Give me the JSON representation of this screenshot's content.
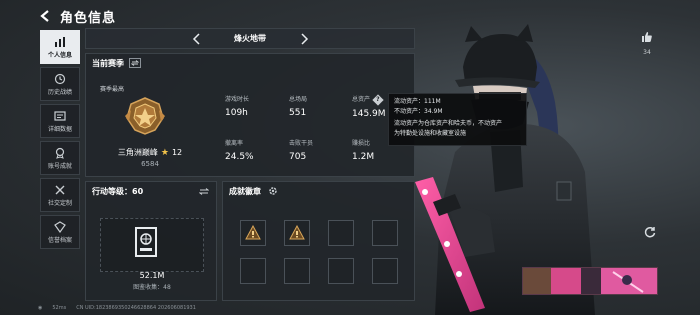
{
  "header": {
    "title": "角色信息"
  },
  "nav": {
    "items": [
      {
        "label": "个人信息",
        "icon": "bar-chart-icon",
        "active": true
      },
      {
        "label": "历史战绩",
        "icon": "history-icon",
        "active": false
      },
      {
        "label": "详细数据",
        "icon": "detail-data-icon",
        "active": false
      },
      {
        "label": "账号成就",
        "icon": "achievement-icon",
        "active": false
      },
      {
        "label": "社交定制",
        "icon": "social-custom-icon",
        "active": false
      },
      {
        "label": "信誉档案",
        "icon": "credit-file-icon",
        "active": false
      }
    ]
  },
  "season": {
    "name": "烽火地带"
  },
  "stats": {
    "title": "当前赛季",
    "subtitle": "赛季最高",
    "rank_name": "三角洲巅峰",
    "rank_level": "12",
    "rank_score": "6584",
    "items": [
      {
        "label": "游戏时长",
        "value": "109h"
      },
      {
        "label": "总场局",
        "value": "551"
      },
      {
        "label": "总资产",
        "value": "145.9M"
      },
      {
        "label": "撤离率",
        "value": "24.5%"
      },
      {
        "label": "击败干员",
        "value": "705"
      },
      {
        "label": "赚损比",
        "value": "1.2M"
      }
    ]
  },
  "tooltip": {
    "liquid": "流动资产：111M",
    "fixed": "不动资产：34.9M",
    "note_line1": "流动资产为仓库资产和哈夫币，不动资产",
    "note_line2": "为特勤处设施和收藏室设施"
  },
  "level": {
    "title": "行动等级：60",
    "value": "52.1M",
    "sub": "图鉴收集：48"
  },
  "achievements": {
    "title": "成就徽章",
    "slots": [
      true,
      true,
      false,
      false,
      false,
      false,
      false,
      false
    ]
  },
  "like": {
    "count": "34"
  },
  "footer": {
    "ping": "52ms",
    "uid": "CN UID:1823869350246628864  202606081931"
  },
  "colors": {
    "accent_star": "#f1c24a",
    "active_nav": "#e9ecef",
    "panel": "#22262a"
  }
}
